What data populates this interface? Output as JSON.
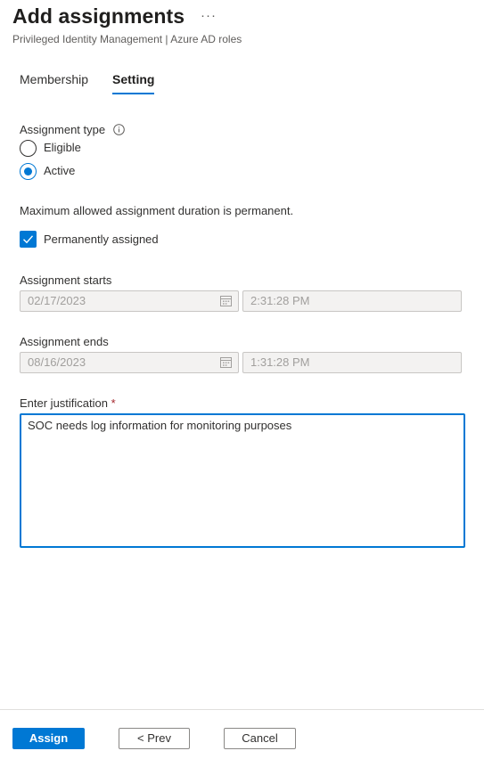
{
  "header": {
    "title": "Add assignments",
    "more_label": "···",
    "subtitle": "Privileged Identity Management | Azure AD roles"
  },
  "tabs": [
    {
      "label": "Membership",
      "active": false
    },
    {
      "label": "Setting",
      "active": true
    }
  ],
  "assignment_type": {
    "label": "Assignment type",
    "info_icon": "info-icon",
    "options": [
      {
        "label": "Eligible",
        "selected": false
      },
      {
        "label": "Active",
        "selected": true
      }
    ]
  },
  "duration_note": "Maximum allowed assignment duration is permanent.",
  "permanent": {
    "label": "Permanently assigned",
    "checked": true
  },
  "assignment_starts": {
    "label": "Assignment starts",
    "date": "02/17/2023",
    "time": "2:31:28 PM"
  },
  "assignment_ends": {
    "label": "Assignment ends",
    "date": "08/16/2023",
    "time": "1:31:28 PM"
  },
  "justification": {
    "label": "Enter justification",
    "required_marker": "*",
    "value": "SOC needs log information for monitoring purposes"
  },
  "footer": {
    "assign_label": "Assign",
    "prev_label": "< Prev",
    "cancel_label": "Cancel"
  },
  "colors": {
    "accent": "#0078d4",
    "required": "#a4262c"
  }
}
